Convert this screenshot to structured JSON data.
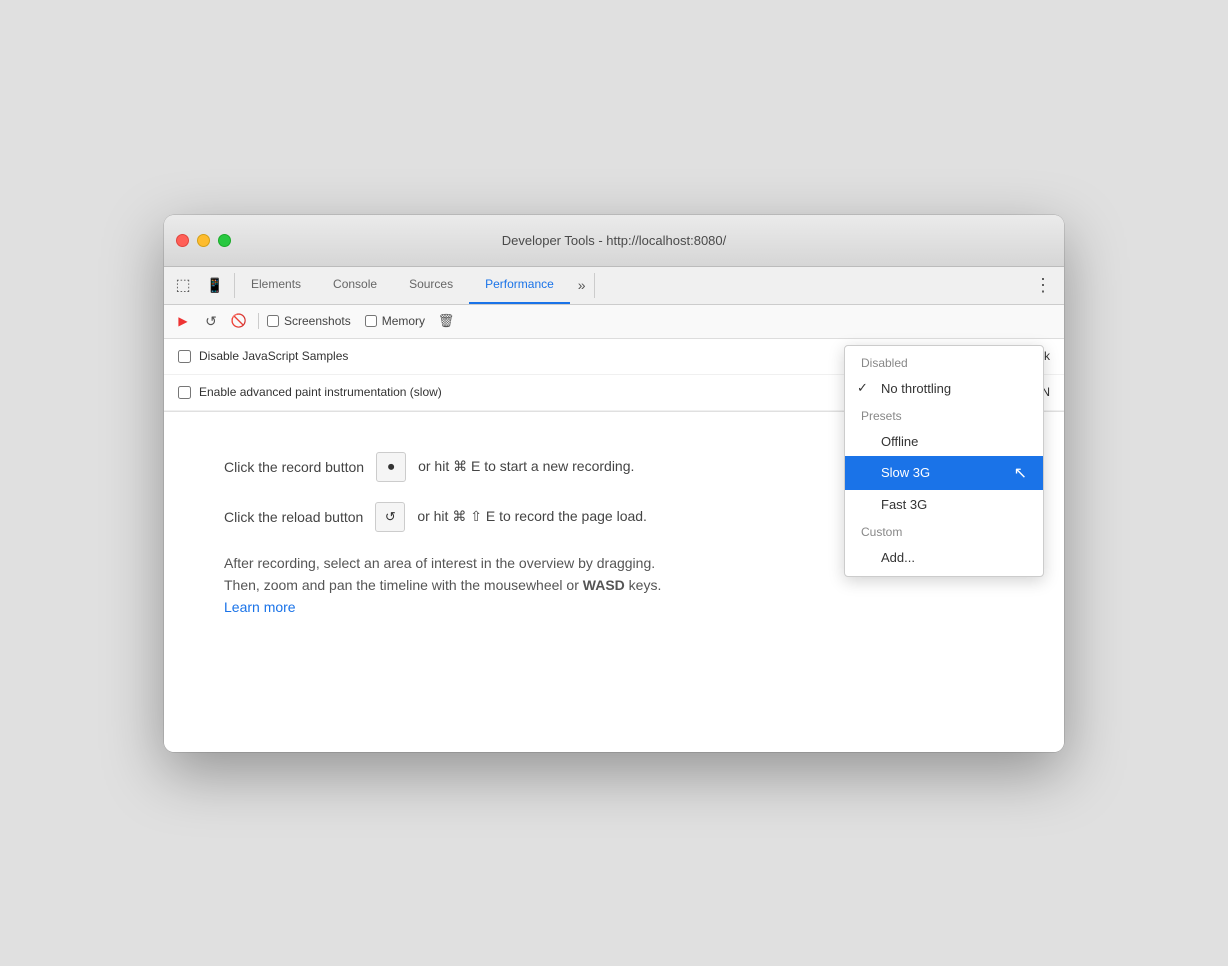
{
  "window": {
    "title": "Developer Tools - http://localhost:8080/"
  },
  "tabs": [
    {
      "id": "elements",
      "label": "Elements",
      "active": false
    },
    {
      "id": "console",
      "label": "Console",
      "active": false
    },
    {
      "id": "sources",
      "label": "Sources",
      "active": false
    },
    {
      "id": "performance",
      "label": "Performance",
      "active": true
    }
  ],
  "tab_more_label": "»",
  "tab_menu_label": "⋮",
  "perf_toolbar": {
    "record_label": "▶",
    "reload_label": "↺",
    "clear_label": "🚫",
    "screenshots_label": "Screenshots",
    "memory_label": "Memory",
    "delete_label": "🗑"
  },
  "settings_rows": [
    {
      "id": "disable-js",
      "label": "Disable JavaScript Samples",
      "control_label": "Network",
      "checked": false
    },
    {
      "id": "enable-paint",
      "label": "Enable advanced paint instrumentation (slow)",
      "control_label": "CPU:  N",
      "checked": false
    }
  ],
  "instructions": {
    "record_line": "Click the record button",
    "record_shortcut": "or hit ⌘ E to start a new recording.",
    "reload_line": "Click the reload button",
    "reload_shortcut": "or hit ⌘ ⇧ E to record the page load.",
    "after_text_1": "After recording, select an area of interest in the overview by dragging.",
    "after_text_2": "Then, zoom and pan the timeline with the mousewheel or ",
    "after_text_bold": "WASD",
    "after_text_3": " keys.",
    "learn_more": "Learn more"
  },
  "dropdown": {
    "items": [
      {
        "id": "disabled",
        "label": "Disabled",
        "type": "category",
        "checked": false
      },
      {
        "id": "no-throttling",
        "label": "No throttling",
        "type": "item",
        "checked": true
      },
      {
        "id": "presets",
        "label": "Presets",
        "type": "category",
        "checked": false
      },
      {
        "id": "offline",
        "label": "Offline",
        "type": "item",
        "checked": false
      },
      {
        "id": "slow-3g",
        "label": "Slow 3G",
        "type": "item",
        "checked": false,
        "selected": true
      },
      {
        "id": "fast-3g",
        "label": "Fast 3G",
        "type": "item",
        "checked": false
      },
      {
        "id": "custom",
        "label": "Custom",
        "type": "category",
        "checked": false
      },
      {
        "id": "add",
        "label": "Add...",
        "type": "item",
        "checked": false
      }
    ]
  },
  "colors": {
    "active_tab": "#1a73e8",
    "selected_item": "#1a73e8"
  }
}
